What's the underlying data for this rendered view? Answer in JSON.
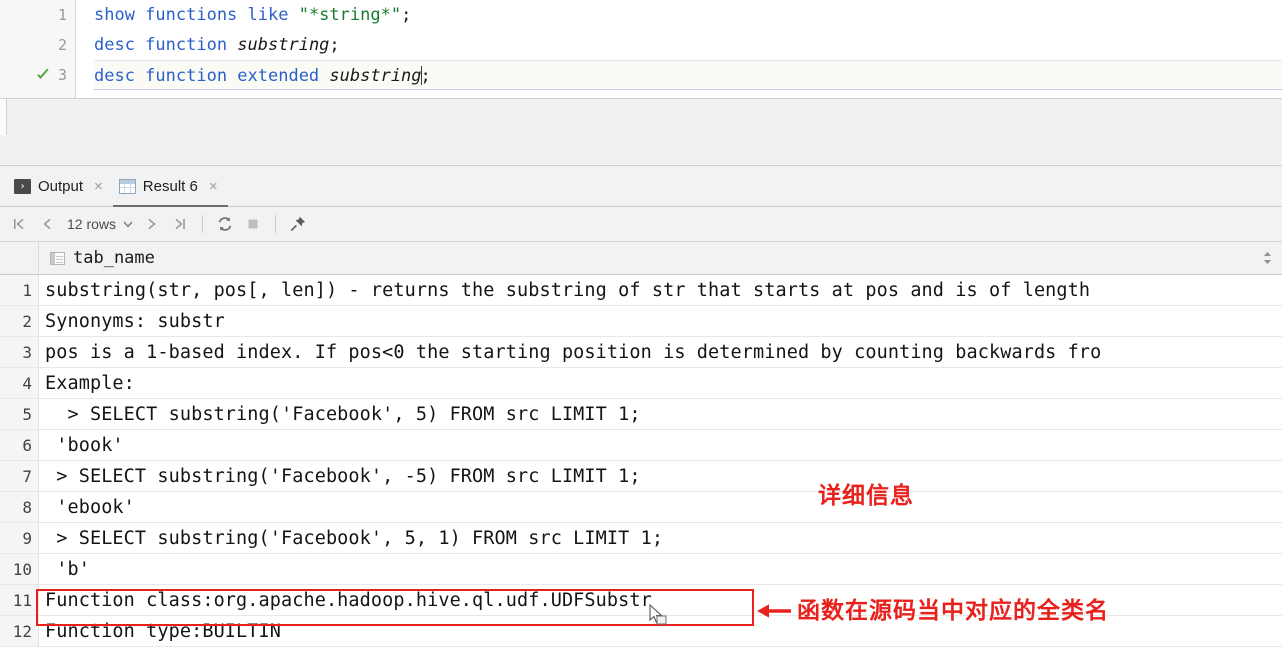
{
  "editor": {
    "lines": [
      {
        "num": "1",
        "tokens": [
          {
            "t": "show functions like ",
            "c": "kw"
          },
          {
            "t": "\"*string*\"",
            "c": "str"
          },
          {
            "t": ";",
            "c": "punct"
          }
        ],
        "current": false,
        "status": ""
      },
      {
        "num": "2",
        "tokens": [
          {
            "t": "desc function ",
            "c": "kw"
          },
          {
            "t": "substring",
            "c": "ident"
          },
          {
            "t": ";",
            "c": "punct"
          }
        ],
        "current": false,
        "status": ""
      },
      {
        "num": "3",
        "tokens": [
          {
            "t": "desc function extended ",
            "c": "kw"
          },
          {
            "t": "substring",
            "c": "ident"
          },
          {
            "t": ";",
            "c": "punct"
          }
        ],
        "current": true,
        "status": "check-mark-icon"
      }
    ]
  },
  "tabs": [
    {
      "label": "Output",
      "icon": "console-output-icon",
      "active": false,
      "close": "×"
    },
    {
      "label": "Result 6",
      "icon": "table-grid-icon",
      "active": true,
      "close": "×"
    }
  ],
  "toolbar": {
    "first_page": "|‹",
    "prev_page": "‹",
    "rows_label": "12 rows",
    "rows_caret": "⌄",
    "next_page": "›",
    "last_page": "›|",
    "refresh": "↻",
    "stop": "■",
    "pin": "⚑"
  },
  "grid": {
    "column_header": "tab_name",
    "sort_up": "▲",
    "sort_down": "▼",
    "rows": [
      {
        "n": "1",
        "v": "substring(str, pos[, len]) - returns the substring of str that starts at pos and is of length"
      },
      {
        "n": "2",
        "v": "Synonyms: substr"
      },
      {
        "n": "3",
        "v": "pos is a 1-based index. If pos<0 the starting position is determined by counting backwards fro"
      },
      {
        "n": "4",
        "v": "Example:"
      },
      {
        "n": "5",
        "v": "  > SELECT substring('Facebook', 5) FROM src LIMIT 1;"
      },
      {
        "n": "6",
        "v": " 'book'"
      },
      {
        "n": "7",
        "v": " > SELECT substring('Facebook', -5) FROM src LIMIT 1;"
      },
      {
        "n": "8",
        "v": " 'ebook'"
      },
      {
        "n": "9",
        "v": " > SELECT substring('Facebook', 5, 1) FROM src LIMIT 1;"
      },
      {
        "n": "10",
        "v": " 'b'"
      },
      {
        "n": "11",
        "v": "Function class:org.apache.hadoop.hive.ql.udf.UDFSubstr"
      },
      {
        "n": "12",
        "v": "Function type:BUILTIN"
      }
    ]
  },
  "annotations": {
    "detail_text": "详细信息",
    "class_text": "函数在源码当中对应的全类名",
    "box_color": "#e8211c",
    "text_color": "#e8211c"
  },
  "colors": {
    "keyword": "#2b5fc9",
    "string": "#177d2e",
    "identifier": "#1a1a1a",
    "check": "#5aa44a",
    "annotation_red": "#e8211c"
  }
}
